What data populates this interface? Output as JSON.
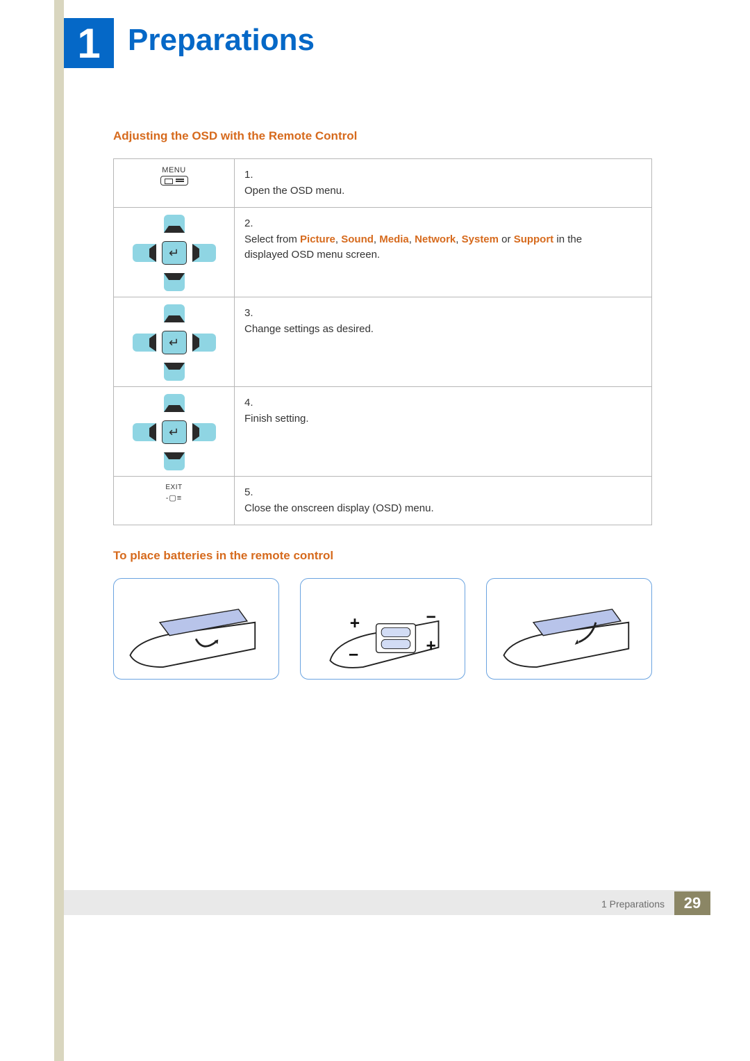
{
  "chapter": {
    "number": "1",
    "title": "Preparations"
  },
  "section1_title": "Adjusting the OSD with the Remote Control",
  "steps": [
    {
      "num": "1.",
      "text_plain": "Open the OSD menu."
    },
    {
      "num": "2.",
      "text_prefix": "Select from ",
      "options": [
        "Picture",
        "Sound",
        "Media",
        "Network",
        "System",
        "Support"
      ],
      "joiner": ", ",
      "last_joiner": " or ",
      "text_suffix": " in the displayed OSD menu screen."
    },
    {
      "num": "3.",
      "text_plain": "Change settings as desired."
    },
    {
      "num": "4.",
      "text_plain": "Finish setting."
    },
    {
      "num": "5.",
      "text_plain": "Close the onscreen display (OSD) menu."
    }
  ],
  "icons": {
    "menu_label": "MENU",
    "exit_label": "EXIT",
    "enter_symbol": "↵"
  },
  "section2_title": "To place batteries in the remote control",
  "battery_symbols": {
    "plus": "+",
    "minus": "−"
  },
  "footer": {
    "label": "1 Preparations",
    "page": "29"
  }
}
